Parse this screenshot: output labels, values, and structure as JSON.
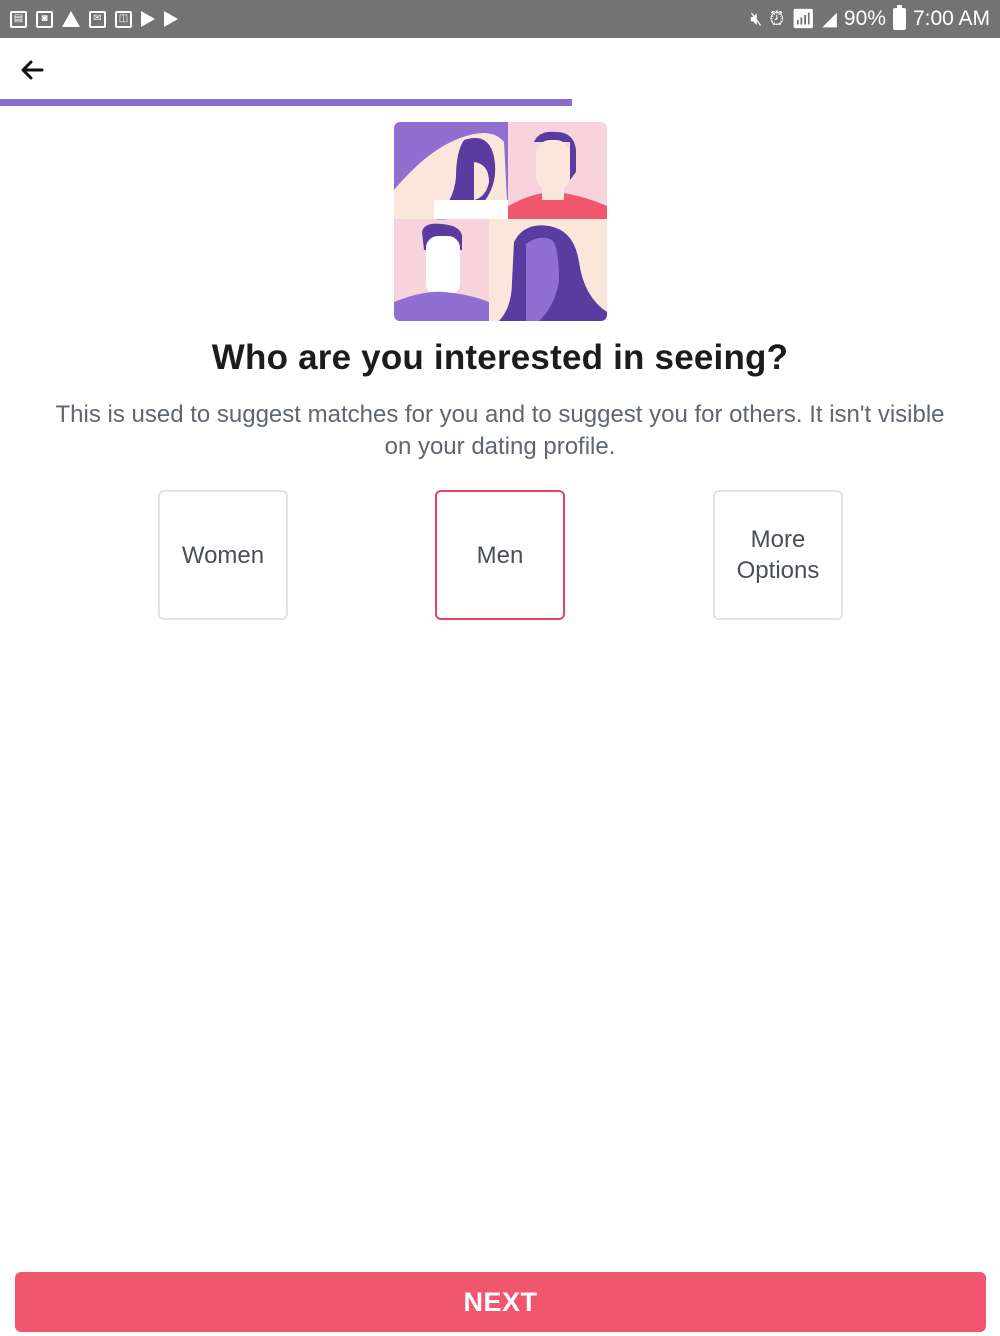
{
  "status_bar": {
    "left_icons": [
      "notification-icon",
      "android-icon",
      "warning-icon",
      "mail-icon",
      "photo-icon",
      "play-store-icon",
      "play-store-icon"
    ],
    "right_icons": [
      "mute-icon",
      "alarm-icon",
      "wifi-icon",
      "signal-icon"
    ],
    "battery": "90%",
    "time": "7:00 AM"
  },
  "header": {
    "back_icon": "back-arrow-icon",
    "progress": 0.572,
    "accent_color": "#8a6bcc"
  },
  "illustration": {
    "icon": "people-collage-illustration"
  },
  "content": {
    "title": "Who are you interested in seeing?",
    "subtitle": "This is used to suggest matches for you and to suggest you for others. It isn't visible on your dating profile."
  },
  "options": [
    {
      "label": "Women",
      "selected": false
    },
    {
      "label": "Men",
      "selected": true
    },
    {
      "label": "More Options",
      "selected": false
    }
  ],
  "footer": {
    "next_label": "NEXT",
    "button_color": "#f0566e",
    "selected_border_color": "#e64560"
  }
}
